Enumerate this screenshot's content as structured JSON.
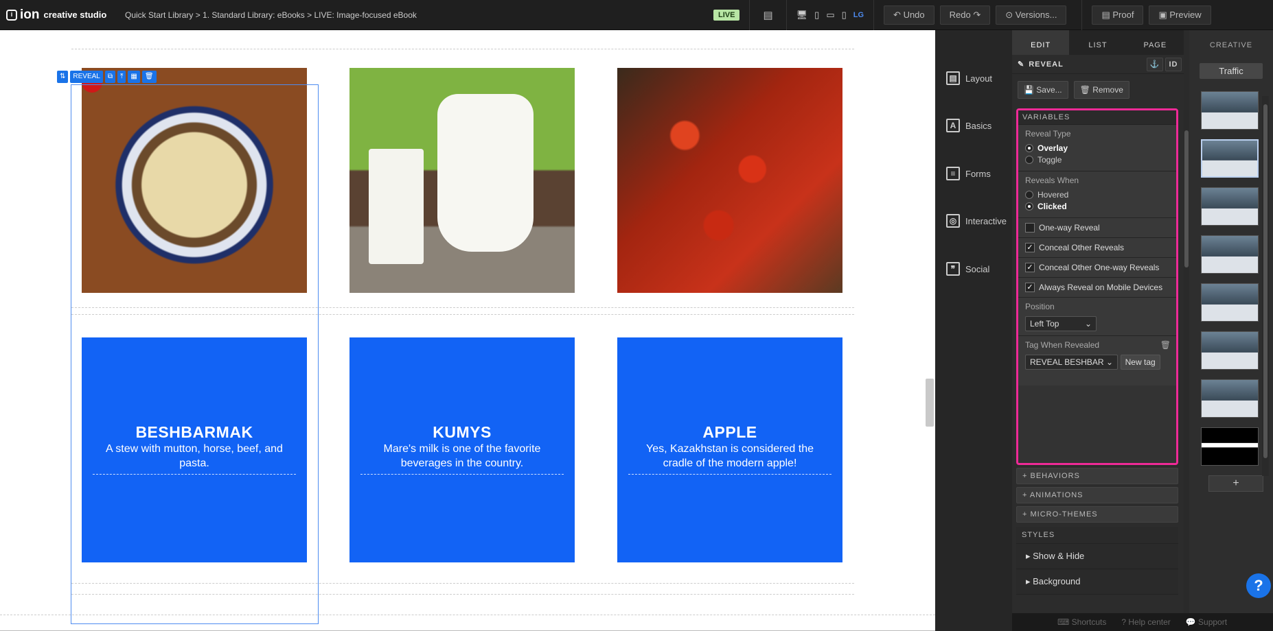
{
  "header": {
    "logo_mark": "ion",
    "logo_sub": "creative studio",
    "breadcrumb": "Quick Start Library > 1. Standard Library: eBooks > LIVE: Image-focused eBook",
    "status_badge": "LIVE",
    "device_label": "LG",
    "undo_label": "Undo",
    "redo_label": "Redo",
    "versions_label": "Versions...",
    "proof_label": "Proof",
    "preview_label": "Preview"
  },
  "canvas": {
    "reveal_tag": "REVEAL",
    "cards": [
      {
        "title": "BESHBARMAK",
        "desc": "A stew with mutton, horse, beef, and pasta."
      },
      {
        "title": "KUMYS",
        "desc": "Mare's milk is one of the favorite beverages in the country."
      },
      {
        "title": "APPLE",
        "desc": "Yes, Kazakhstan is considered the cradle of the modern apple!"
      }
    ]
  },
  "left_panel": {
    "items": [
      {
        "label": "Layout",
        "icon": "layout-icon"
      },
      {
        "label": "Basics",
        "icon": "basics-icon"
      },
      {
        "label": "Forms",
        "icon": "forms-icon"
      },
      {
        "label": "Interactive",
        "icon": "interactive-icon"
      },
      {
        "label": "Social",
        "icon": "social-icon"
      }
    ]
  },
  "props": {
    "tabs": [
      "EDIT",
      "LIST",
      "PAGE"
    ],
    "active_tab": "EDIT",
    "element_name": "REVEAL",
    "id_label": "ID",
    "save_label": "Save...",
    "remove_label": "Remove",
    "variables_label": "VARIABLES",
    "reveal_type_label": "Reveal Type",
    "reveal_type_options": [
      "Overlay",
      "Toggle"
    ],
    "reveal_type_selected": "Overlay",
    "reveals_when_label": "Reveals When",
    "reveals_when_options": [
      "Hovered",
      "Clicked"
    ],
    "reveals_when_selected": "Clicked",
    "one_way_label": "One-way Reveal",
    "one_way_checked": false,
    "conceal_others_label": "Conceal Other Reveals",
    "conceal_others_checked": true,
    "conceal_one_way_label": "Conceal Other One-way Reveals",
    "conceal_one_way_checked": true,
    "always_mobile_label": "Always Reveal on Mobile Devices",
    "always_mobile_checked": true,
    "position_label": "Position",
    "position_value": "Left Top",
    "tag_label": "Tag When Revealed",
    "tag_value": "REVEAL BESHBAR",
    "new_tag_label": "New tag",
    "behaviors_label": "+ BEHAVIORS",
    "animations_label": "+ ANIMATIONS",
    "microthemes_label": "+ MICRO-THEMES",
    "styles_label": "STYLES",
    "show_hide_label": "Show & Hide",
    "background_label": "Background"
  },
  "creative": {
    "header": "CREATIVE",
    "traffic_label": "Traffic",
    "add_label": "+"
  },
  "footer": {
    "shortcuts": "Shortcuts",
    "help": "Help center",
    "support": "Support"
  },
  "colors": {
    "accent": "#1263f5",
    "highlight": "#ee2a97",
    "live_badge": "#b8e6a4"
  }
}
